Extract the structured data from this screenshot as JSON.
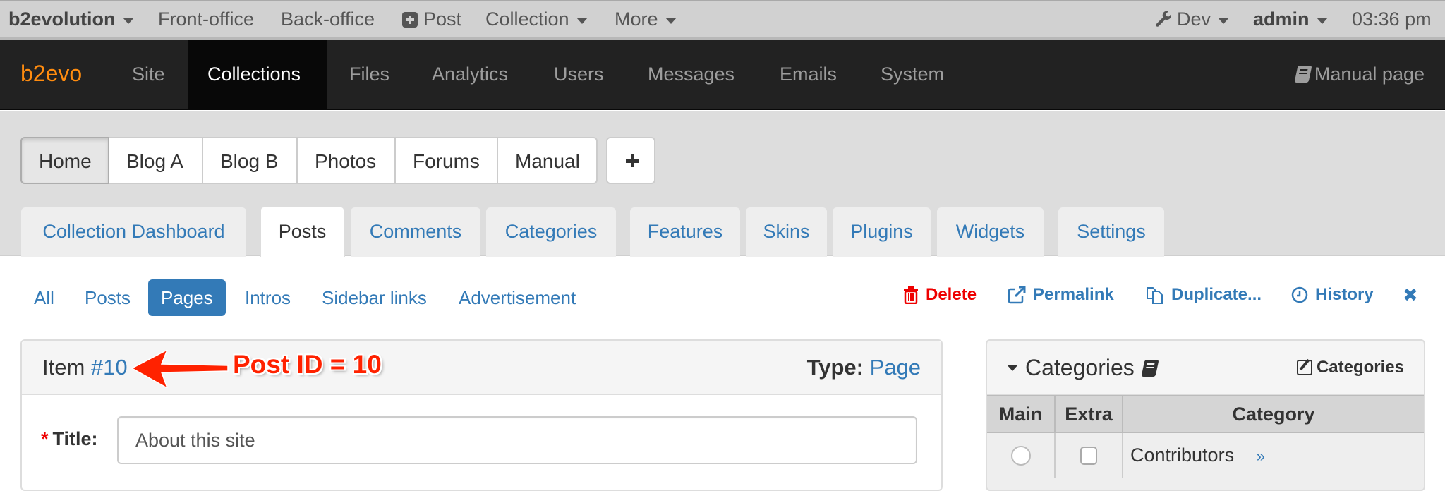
{
  "topbar": {
    "brand": "b2evolution",
    "front_office": "Front-office",
    "back_office": "Back-office",
    "post": "Post",
    "collection": "Collection",
    "more": "More",
    "dev": "Dev",
    "user": "admin",
    "time": "03:36 pm"
  },
  "navbar": {
    "logo": "b2evo",
    "items": [
      {
        "label": "Site"
      },
      {
        "label": "Collections",
        "active": true
      },
      {
        "label": "Files"
      },
      {
        "label": "Analytics"
      },
      {
        "label": "Users"
      },
      {
        "label": "Messages"
      },
      {
        "label": "Emails"
      },
      {
        "label": "System"
      }
    ],
    "manual": "Manual page"
  },
  "collections": {
    "items": [
      "Home",
      "Blog A",
      "Blog B",
      "Photos",
      "Forums",
      "Manual"
    ],
    "active": "Home"
  },
  "tabs": {
    "items": [
      "Collection Dashboard",
      "Posts",
      "Comments",
      "Categories",
      "Features",
      "Skins",
      "Plugins",
      "Widgets",
      "Settings"
    ],
    "active": "Posts"
  },
  "subtabs": {
    "items": [
      "All",
      "Posts",
      "Pages",
      "Intros",
      "Sidebar links",
      "Advertisement"
    ],
    "active": "Pages"
  },
  "actions": {
    "delete": "Delete",
    "permalink": "Permalink",
    "duplicate": "Duplicate...",
    "history": "History",
    "close": "✖"
  },
  "item": {
    "label": "Item",
    "id": "#10",
    "type_label": "Type:",
    "type_value": "Page",
    "annotation": "Post ID = 10",
    "title_label": "Title:",
    "required_mark": "*",
    "title_value": "About this site"
  },
  "categories_panel": {
    "title": "Categories",
    "edit_label": "Categories",
    "columns": [
      "Main",
      "Extra",
      "Category"
    ],
    "rows": [
      {
        "name": "Contributors",
        "main": false,
        "extra": false,
        "link": "»"
      }
    ]
  },
  "colors": {
    "brand_orange": "#ff8c0f",
    "link_blue": "#337ab7",
    "danger_red": "#ee0000",
    "annotation_red": "#ff2200",
    "navbar_bg": "#222222"
  }
}
